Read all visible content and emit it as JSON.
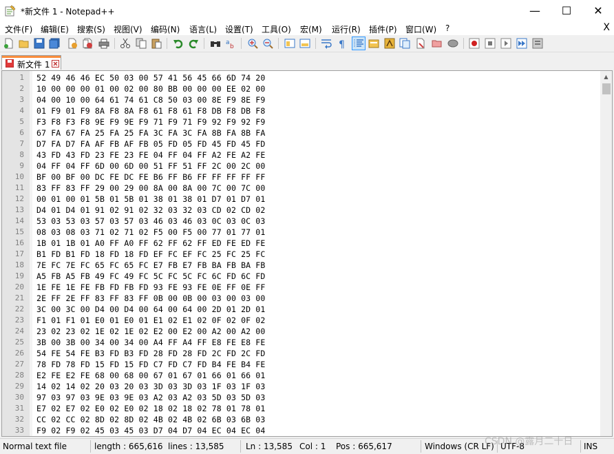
{
  "window": {
    "title": "*新文件 1 - Notepad++",
    "min_glyph": "—",
    "max_glyph": "☐",
    "close_glyph": "✕"
  },
  "menu": {
    "items": [
      "文件(F)",
      "编辑(E)",
      "搜索(S)",
      "视图(V)",
      "编码(N)",
      "语言(L)",
      "设置(T)",
      "工具(O)",
      "宏(M)",
      "运行(R)",
      "插件(P)",
      "窗口(W)",
      "?"
    ],
    "close_glyph": "X"
  },
  "tab": {
    "label": "新文件 1",
    "accent_color": "#fa8c3c"
  },
  "editor": {
    "lines": [
      {
        "n": "1",
        "text": "52 49 46 46 EC 50 03 00 57 41 56 45 66 6D 74 20"
      },
      {
        "n": "2",
        "text": "10 00 00 00 01 00 02 00 80 BB 00 00 00 EE 02 00"
      },
      {
        "n": "3",
        "text": "04 00 10 00 64 61 74 61 C8 50 03 00 8E F9 8E F9"
      },
      {
        "n": "4",
        "text": "01 F9 01 F9 8A F8 8A F8 61 F8 61 F8 DB F8 DB F8"
      },
      {
        "n": "5",
        "text": "F3 F8 F3 F8 9E F9 9E F9 71 F9 71 F9 92 F9 92 F9"
      },
      {
        "n": "6",
        "text": "67 FA 67 FA 25 FA 25 FA 3C FA 3C FA 8B FA 8B FA"
      },
      {
        "n": "7",
        "text": "D7 FA D7 FA AF FB AF FB 05 FD 05 FD 45 FD 45 FD"
      },
      {
        "n": "8",
        "text": "43 FD 43 FD 23 FE 23 FE 04 FF 04 FF A2 FE A2 FE"
      },
      {
        "n": "9",
        "text": "04 FF 04 FF 6D 00 6D 00 51 FF 51 FF 2C 00 2C 00"
      },
      {
        "n": "10",
        "text": "BF 00 BF 00 DC FE DC FE B6 FF B6 FF FF FF FF FF"
      },
      {
        "n": "11",
        "text": "83 FF 83 FF 29 00 29 00 8A 00 8A 00 7C 00 7C 00"
      },
      {
        "n": "12",
        "text": "00 01 00 01 5B 01 5B 01 38 01 38 01 D7 01 D7 01"
      },
      {
        "n": "13",
        "text": "D4 01 D4 01 91 02 91 02 32 03 32 03 CD 02 CD 02"
      },
      {
        "n": "14",
        "text": "53 03 53 03 57 03 57 03 46 03 46 03 0C 03 0C 03"
      },
      {
        "n": "15",
        "text": "08 03 08 03 71 02 71 02 F5 00 F5 00 77 01 77 01"
      },
      {
        "n": "16",
        "text": "1B 01 1B 01 A0 FF A0 FF 62 FF 62 FF ED FE ED FE"
      },
      {
        "n": "17",
        "text": "B1 FD B1 FD 18 FD 18 FD EF FC EF FC 25 FC 25 FC"
      },
      {
        "n": "18",
        "text": "7E FC 7E FC 65 FC 65 FC E7 FB E7 FB BA FB BA FB"
      },
      {
        "n": "19",
        "text": "A5 FB A5 FB 49 FC 49 FC 5C FC 5C FC 6C FD 6C FD"
      },
      {
        "n": "20",
        "text": "1E FE 1E FE FB FD FB FD 93 FE 93 FE 0E FF 0E FF"
      },
      {
        "n": "21",
        "text": "2E FF 2E FF 83 FF 83 FF 0B 00 0B 00 03 00 03 00"
      },
      {
        "n": "22",
        "text": "3C 00 3C 00 D4 00 D4 00 64 00 64 00 2D 01 2D 01"
      },
      {
        "n": "23",
        "text": "F1 01 F1 01 E0 01 E0 01 E1 02 E1 02 0F 02 0F 02"
      },
      {
        "n": "24",
        "text": "23 02 23 02 1E 02 1E 02 E2 00 E2 00 A2 00 A2 00"
      },
      {
        "n": "25",
        "text": "3B 00 3B 00 34 00 34 00 A4 FF A4 FF E8 FE E8 FE"
      },
      {
        "n": "26",
        "text": "54 FE 54 FE B3 FD B3 FD 28 FD 28 FD 2C FD 2C FD"
      },
      {
        "n": "27",
        "text": "78 FD 78 FD 15 FD 15 FD C7 FD C7 FD B4 FE B4 FE"
      },
      {
        "n": "28",
        "text": "E2 FE E2 FE 68 00 68 00 67 01 67 01 66 01 66 01"
      },
      {
        "n": "29",
        "text": "14 02 14 02 20 03 20 03 3D 03 3D 03 1F 03 1F 03"
      },
      {
        "n": "30",
        "text": "97 03 97 03 9E 03 9E 03 A2 03 A2 03 5D 03 5D 03"
      },
      {
        "n": "31",
        "text": "E7 02 E7 02 E0 02 E0 02 18 02 18 02 78 01 78 01"
      },
      {
        "n": "32",
        "text": "CC 02 CC 02 8D 02 8D 02 4B 02 4B 02 6B 03 6B 03"
      },
      {
        "n": "33",
        "text": "F9 02 F9 02 45 03 45 03 D7 04 D7 04 EC 04 EC 04"
      }
    ]
  },
  "status": {
    "file_type": "Normal text file",
    "length": "length : 665,616",
    "lines": "lines : 13,585",
    "ln": "Ln : 13,585",
    "col": "Col : 1",
    "pos": "Pos : 665,617",
    "eol": "Windows (CR LF)",
    "encoding": "UTF-8",
    "mode": "INS"
  },
  "watermark": "CSDN @露月二十日",
  "icons": [
    "new-file-icon",
    "open-file-icon",
    "save-icon",
    "save-all-icon",
    "close-icon",
    "close-all-icon",
    "print-icon",
    "cut-icon",
    "copy-icon",
    "paste-icon",
    "undo-icon",
    "redo-icon",
    "find-icon",
    "replace-icon",
    "zoom-in-icon",
    "zoom-out-icon",
    "sync-vertical-icon",
    "sync-horizontal-icon",
    "word-wrap-icon",
    "show-all-chars-icon",
    "indent-guide-icon",
    "udl-icon",
    "doc-map-icon",
    "function-list-icon",
    "folder-workspace-icon",
    "monitor-icon",
    "record-macro-icon",
    "stop-record-icon",
    "play-macro-icon",
    "run-macro-multiple-icon",
    "save-macro-icon"
  ]
}
